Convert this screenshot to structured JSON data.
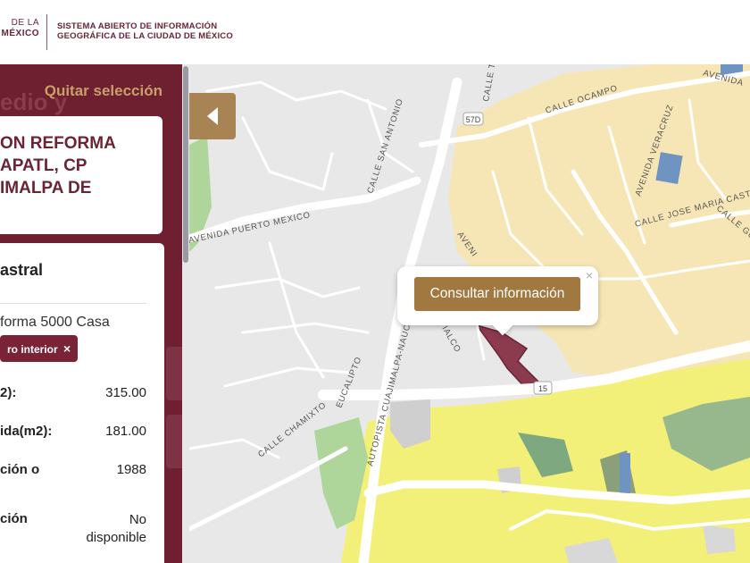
{
  "header": {
    "logo_line1": "DE LA",
    "logo_line2": "MÉXICO",
    "system_line1": "SISTEMA ABIERTO DE INFORMACIÓN",
    "system_line2": "GEOGRÁFICA DE LA CIUDAD DE MÉXICO"
  },
  "sidebar": {
    "background_title": "edio y",
    "clear_selection": "Quitar selección",
    "address_lines": [
      "ON REFORMA",
      "APATL, CP",
      "IMALPA DE"
    ],
    "section_title": "astral",
    "address_detail": "forma 5000 Casa",
    "tag_label": "ro interior",
    "tag_close": "×",
    "rows": [
      {
        "label": "2):",
        "value": "315.00"
      },
      {
        "label": "ida(m2):",
        "value": "181.00"
      },
      {
        "label": "ción o",
        "value": "1988"
      },
      {
        "label": "ción",
        "value": "No disponible"
      }
    ]
  },
  "map": {
    "toggle_icon": "caret-left-icon",
    "streets": [
      "AVENIDA PUERTO MEXICO",
      "CALLE SAN ANTONIO",
      "CALLE OCAMPO",
      "AVENIDA VERACRUZ",
      "CALLE JOSE MARIA CASTORENA",
      "CALLE GUERRERO",
      "AVENIDA",
      "AUTOPISTA CUAJIMALPA-NAUCALPAN",
      "CALLE CHAMIXTO",
      "EUCALIPTO",
      "CALLE TRU",
      "IALCO",
      "AVENI",
      "57D",
      "15"
    ],
    "popup": {
      "button_label": "Consultar información",
      "close": "×"
    },
    "colors": {
      "base": "#e8e8e8",
      "residential": "#f7e6b5",
      "commercial": "#f3f07a",
      "green": "#aed59a",
      "selected_parcel": "#8c3a4e",
      "accent": "#a07840"
    }
  }
}
